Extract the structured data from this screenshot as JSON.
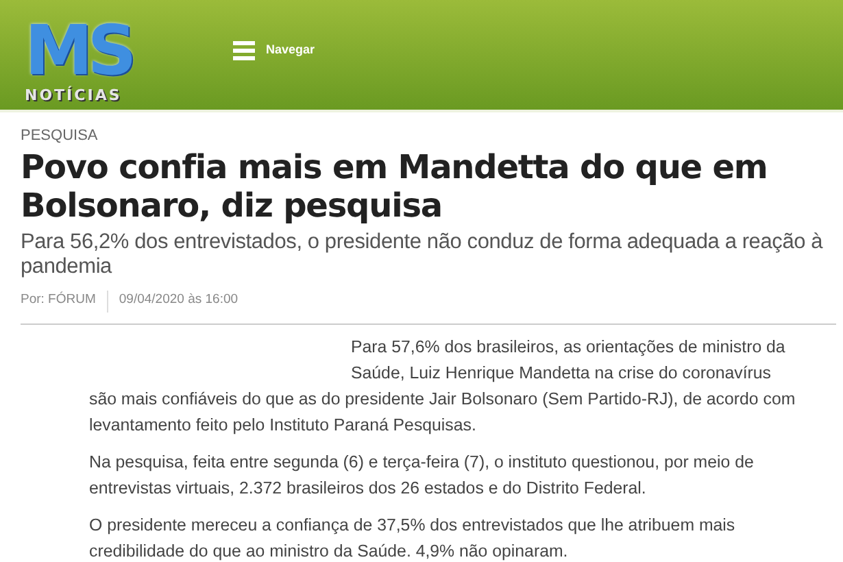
{
  "header": {
    "logo_main": "MS",
    "logo_sub": "NOTÍCIAS",
    "nav_label": "Navegar"
  },
  "article": {
    "category": "PESQUISA",
    "title": "Povo confia mais em Mandetta do que em Bolsonaro, diz pesquisa",
    "subtitle": "Para 56,2% dos entrevistados, o presidente não conduz de forma adequada a reação à pandemia",
    "author": "Por: FÓRUM",
    "date": "09/04/2020 às 16:00",
    "paragraphs": [
      "Para 57,6% dos brasileiros, as orientações de ministro da Saúde, Luiz Henrique Mandetta na crise do coronavírus são mais confiáveis do que as do presidente Jair Bolsonaro (Sem Partido-RJ), de acordo com levantamento feito pelo Instituto Paraná Pesquisas.",
      "Na pesquisa, feita entre segunda (6) e terça-feira (7), o instituto questionou, por meio de entrevistas virtuais, 2.372 brasileiros dos 26 estados e do Distrito Federal.",
      "O presidente mereceu a confiança de 37,5% dos entrevistados que lhe atribuem mais credibilidade do que ao ministro da Saúde. 4,9% não opinaram."
    ]
  }
}
